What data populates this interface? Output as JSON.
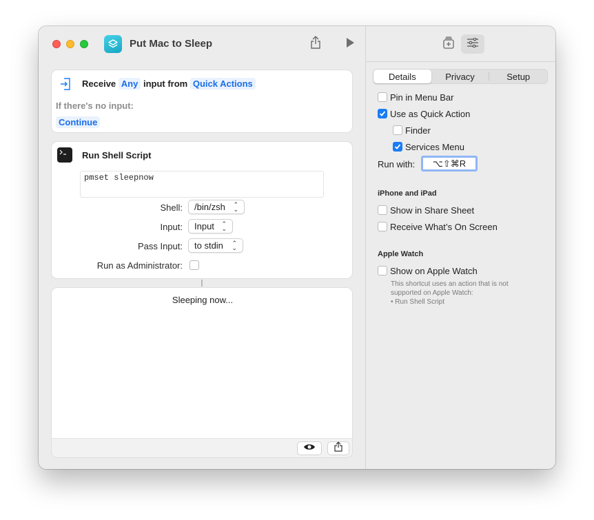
{
  "window": {
    "title": "Put Mac to Sleep"
  },
  "receive_card": {
    "receive_label": "Receive",
    "input_type": "Any",
    "input_from_label": "input from",
    "source": "Quick Actions",
    "no_input_label": "If there's no input:",
    "no_input_action": "Continue"
  },
  "shell_card": {
    "title": "Run Shell Script",
    "script": "pmset sleepnow",
    "shell_label": "Shell:",
    "shell_value": "/bin/zsh",
    "input_label": "Input:",
    "input_value": "Input",
    "pass_input_label": "Pass Input:",
    "pass_input_value": "to stdin",
    "admin_label": "Run as Administrator:",
    "admin_checked": false
  },
  "output_card": {
    "text": "Sleeping now..."
  },
  "details": {
    "tabs": [
      "Details",
      "Privacy",
      "Setup"
    ],
    "active_tab": "Details",
    "pin_menu_bar": "Pin in Menu Bar",
    "use_quick_action": "Use as Quick Action",
    "finder": "Finder",
    "services_menu": "Services Menu",
    "run_with_label": "Run with:",
    "run_with_value": "⌥⇧⌘R",
    "iphone_section": "iPhone and iPad",
    "share_sheet": "Show in Share Sheet",
    "receive_screen": "Receive What’s On Screen",
    "watch_section": "Apple Watch",
    "show_watch": "Show on Apple Watch",
    "watch_note_1": "This shortcut uses an action that is not",
    "watch_note_2": "supported on Apple Watch:",
    "watch_note_3": "• Run Shell Script"
  },
  "colors": {
    "accent": "#1a7cf5",
    "token_bg": "#eaf2fe",
    "token_fg": "#1a6ee5"
  }
}
